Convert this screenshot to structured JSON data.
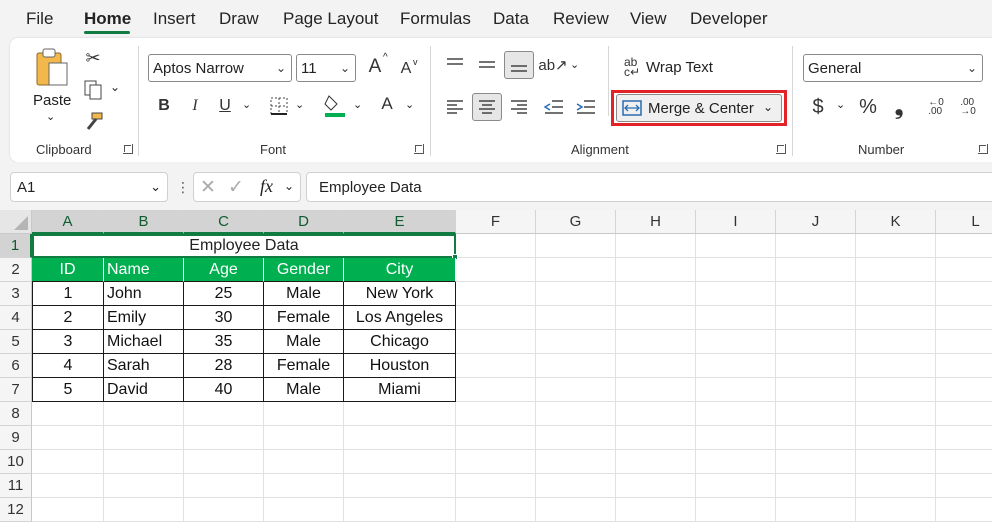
{
  "tabs": [
    "File",
    "Home",
    "Insert",
    "Draw",
    "Page Layout",
    "Formulas",
    "Data",
    "Review",
    "View",
    "Developer"
  ],
  "ribbon": {
    "clipboard": {
      "paste_label": "Paste",
      "group_label": "Clipboard"
    },
    "font": {
      "font_name": "Aptos Narrow",
      "font_size": "11",
      "group_label": "Font",
      "bold": "B",
      "italic": "I",
      "underline": "U",
      "grow": "A",
      "shrink": "A",
      "font_color": "A"
    },
    "alignment": {
      "wrap_text": "Wrap Text",
      "merge_center": "Merge & Center",
      "group_label": "Alignment"
    },
    "number": {
      "format": "General",
      "group_label": "Number",
      "currency": "$",
      "percent": "%",
      "comma": "❟"
    }
  },
  "formula_bar": {
    "name_box": "A1",
    "fx": "fx",
    "content": "Employee Data"
  },
  "colors": {
    "accent": "#107c41",
    "header_fill": "#00b050",
    "highlight": "#e32227"
  },
  "columns": [
    "A",
    "B",
    "C",
    "D",
    "E",
    "F",
    "G",
    "H",
    "I",
    "J",
    "K",
    "L"
  ],
  "rows": [
    "1",
    "2",
    "3",
    "4",
    "5",
    "6",
    "7",
    "8",
    "9",
    "10",
    "11",
    "12"
  ],
  "sheet": {
    "title": "Employee Data",
    "headers": [
      "ID",
      "Name",
      "Age",
      "Gender",
      "City"
    ],
    "data": [
      [
        "1",
        "John",
        "25",
        "Male",
        "New York"
      ],
      [
        "2",
        "Emily",
        "30",
        "Female",
        "Los Angeles"
      ],
      [
        "3",
        "Michael",
        "35",
        "Male",
        "Chicago"
      ],
      [
        "4",
        "Sarah",
        "28",
        "Female",
        "Houston"
      ],
      [
        "5",
        "David",
        "40",
        "Male",
        "Miami"
      ]
    ]
  }
}
